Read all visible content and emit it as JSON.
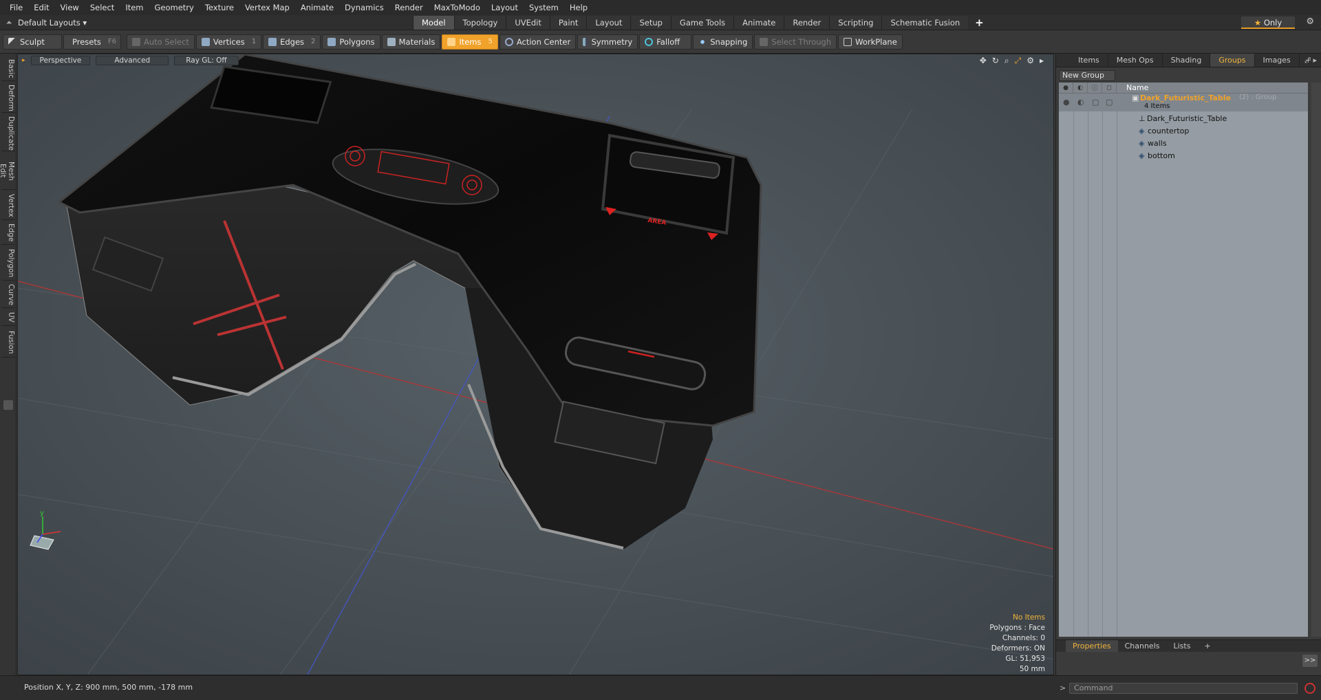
{
  "menu": [
    "File",
    "Edit",
    "View",
    "Select",
    "Item",
    "Geometry",
    "Texture",
    "Vertex Map",
    "Animate",
    "Dynamics",
    "Render",
    "MaxToModo",
    "Layout",
    "System",
    "Help"
  ],
  "layout": {
    "default_layouts": "Default Layouts ▾",
    "tabs": [
      "Model",
      "Topology",
      "UVEdit",
      "Paint",
      "Layout",
      "Setup",
      "Game Tools",
      "Animate",
      "Render",
      "Scripting",
      "Schematic Fusion"
    ],
    "active_tab": "Model",
    "only_label": "Only"
  },
  "toolbar": {
    "sculpt": "Sculpt",
    "presets": "Presets",
    "presets_key": "F6",
    "auto_select": "Auto Select",
    "vertices": "Vertices",
    "vertices_count": "1",
    "edges": "Edges",
    "edges_count": "2",
    "polygons": "Polygons",
    "materials": "Materials",
    "items": "Items",
    "items_count": "5",
    "action_center": "Action Center",
    "symmetry": "Symmetry",
    "falloff": "Falloff",
    "snapping": "Snapping",
    "select_through": "Select Through",
    "workplane": "WorkPlane"
  },
  "left_tabs": [
    "Basic",
    "Deform",
    "Duplicate",
    "Mesh Edit",
    "Vertex",
    "Edge",
    "Polygon",
    "Curve",
    "UV",
    "Fusion"
  ],
  "viewport": {
    "perspective": "Perspective",
    "advanced": "Advanced",
    "raygl": "Ray GL: Off",
    "desk_label": "AREA",
    "info": {
      "no_items": "No Items",
      "polygons": "Polygons : Face",
      "channels": "Channels: 0",
      "deformers": "Deformers: ON",
      "gl": "GL: 51,953",
      "scale": "50 mm"
    },
    "axis_y": "y"
  },
  "right_panel": {
    "tabs": [
      "Items",
      "Mesh Ops",
      "Shading",
      "Groups",
      "Images"
    ],
    "active_tab": "Groups",
    "new_group": "New Group",
    "name_header": "Name",
    "group_name": "Dark_Futuristic_Table",
    "group_meta": "(2) : Group",
    "group_count": "4 Items",
    "children": [
      "Dark_Futuristic_Table",
      "countertop",
      "walls",
      "bottom"
    ],
    "bottom_tabs": [
      "Properties",
      "Channels",
      "Lists"
    ],
    "bottom_active": "Properties"
  },
  "status": {
    "position": "Position X, Y, Z:   900 mm, 500 mm, -178 mm"
  },
  "command": {
    "placeholder": "Command"
  },
  "colors": {
    "accent": "#f0a22a",
    "selected_text": "#f0b43c",
    "viewport_bg": "#4a5055"
  }
}
